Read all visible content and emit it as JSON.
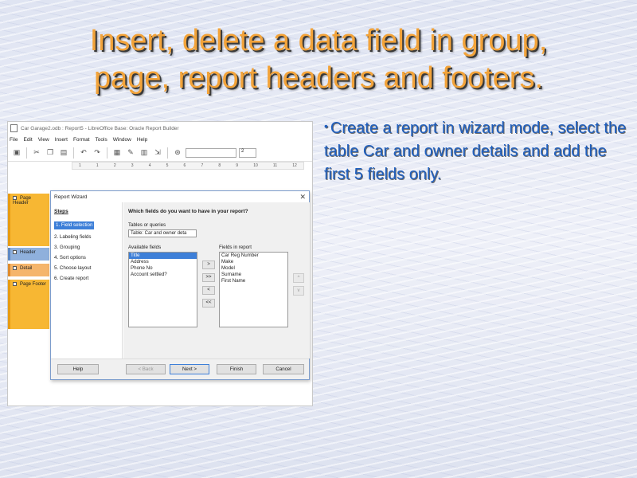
{
  "slide": {
    "title_line1": "Insert, delete a data field in group,",
    "title_line2": "page, report headers and footers.",
    "bullet": "Create a report in wizard mode, select the table Car and owner details and add the first 5 fields only.",
    "title_color": "#f2a33a",
    "bullet_color": "#1f5fbf"
  },
  "window": {
    "title": "Car Garage2.odb : Report5 - LibreOffice Base: Oracle Report Builder",
    "menu": [
      "File",
      "Edit",
      "View",
      "Insert",
      "Format",
      "Tools",
      "Window",
      "Help"
    ],
    "toolbar_value": "2",
    "ruler_ticks": [
      "1",
      "1",
      "2",
      "3",
      "4",
      "5",
      "6",
      "7",
      "8",
      "9",
      "10",
      "11",
      "12"
    ]
  },
  "sections": {
    "page_header": "Page Header",
    "header": "Header",
    "detail": "Detail",
    "page_footer": "Page Footer"
  },
  "wizard": {
    "title": "Report Wizard",
    "steps_title": "Steps",
    "steps": [
      "1. Field selection",
      "2. Labeling fields",
      "3. Grouping",
      "4. Sort options",
      "5. Choose layout",
      "6. Create report"
    ],
    "question": "Which fields do you want to have in your report?",
    "tables_label": "Tables or queries",
    "table_selected": "Table: Car and owner deta",
    "available_label": "Available fields",
    "available_fields": [
      "Title",
      "Address",
      "Phone No",
      "Account settled?"
    ],
    "report_label": "Fields in report",
    "report_fields": [
      "Car Reg Number",
      "Make",
      "Model",
      "Surname",
      "First Name"
    ],
    "move_buttons": [
      ">",
      ">>",
      "<",
      "<<"
    ],
    "up": "^",
    "down": "v",
    "buttons": {
      "help": "Help",
      "back": "< Back",
      "next": "Next >",
      "finish": "Finish",
      "cancel": "Cancel"
    }
  }
}
